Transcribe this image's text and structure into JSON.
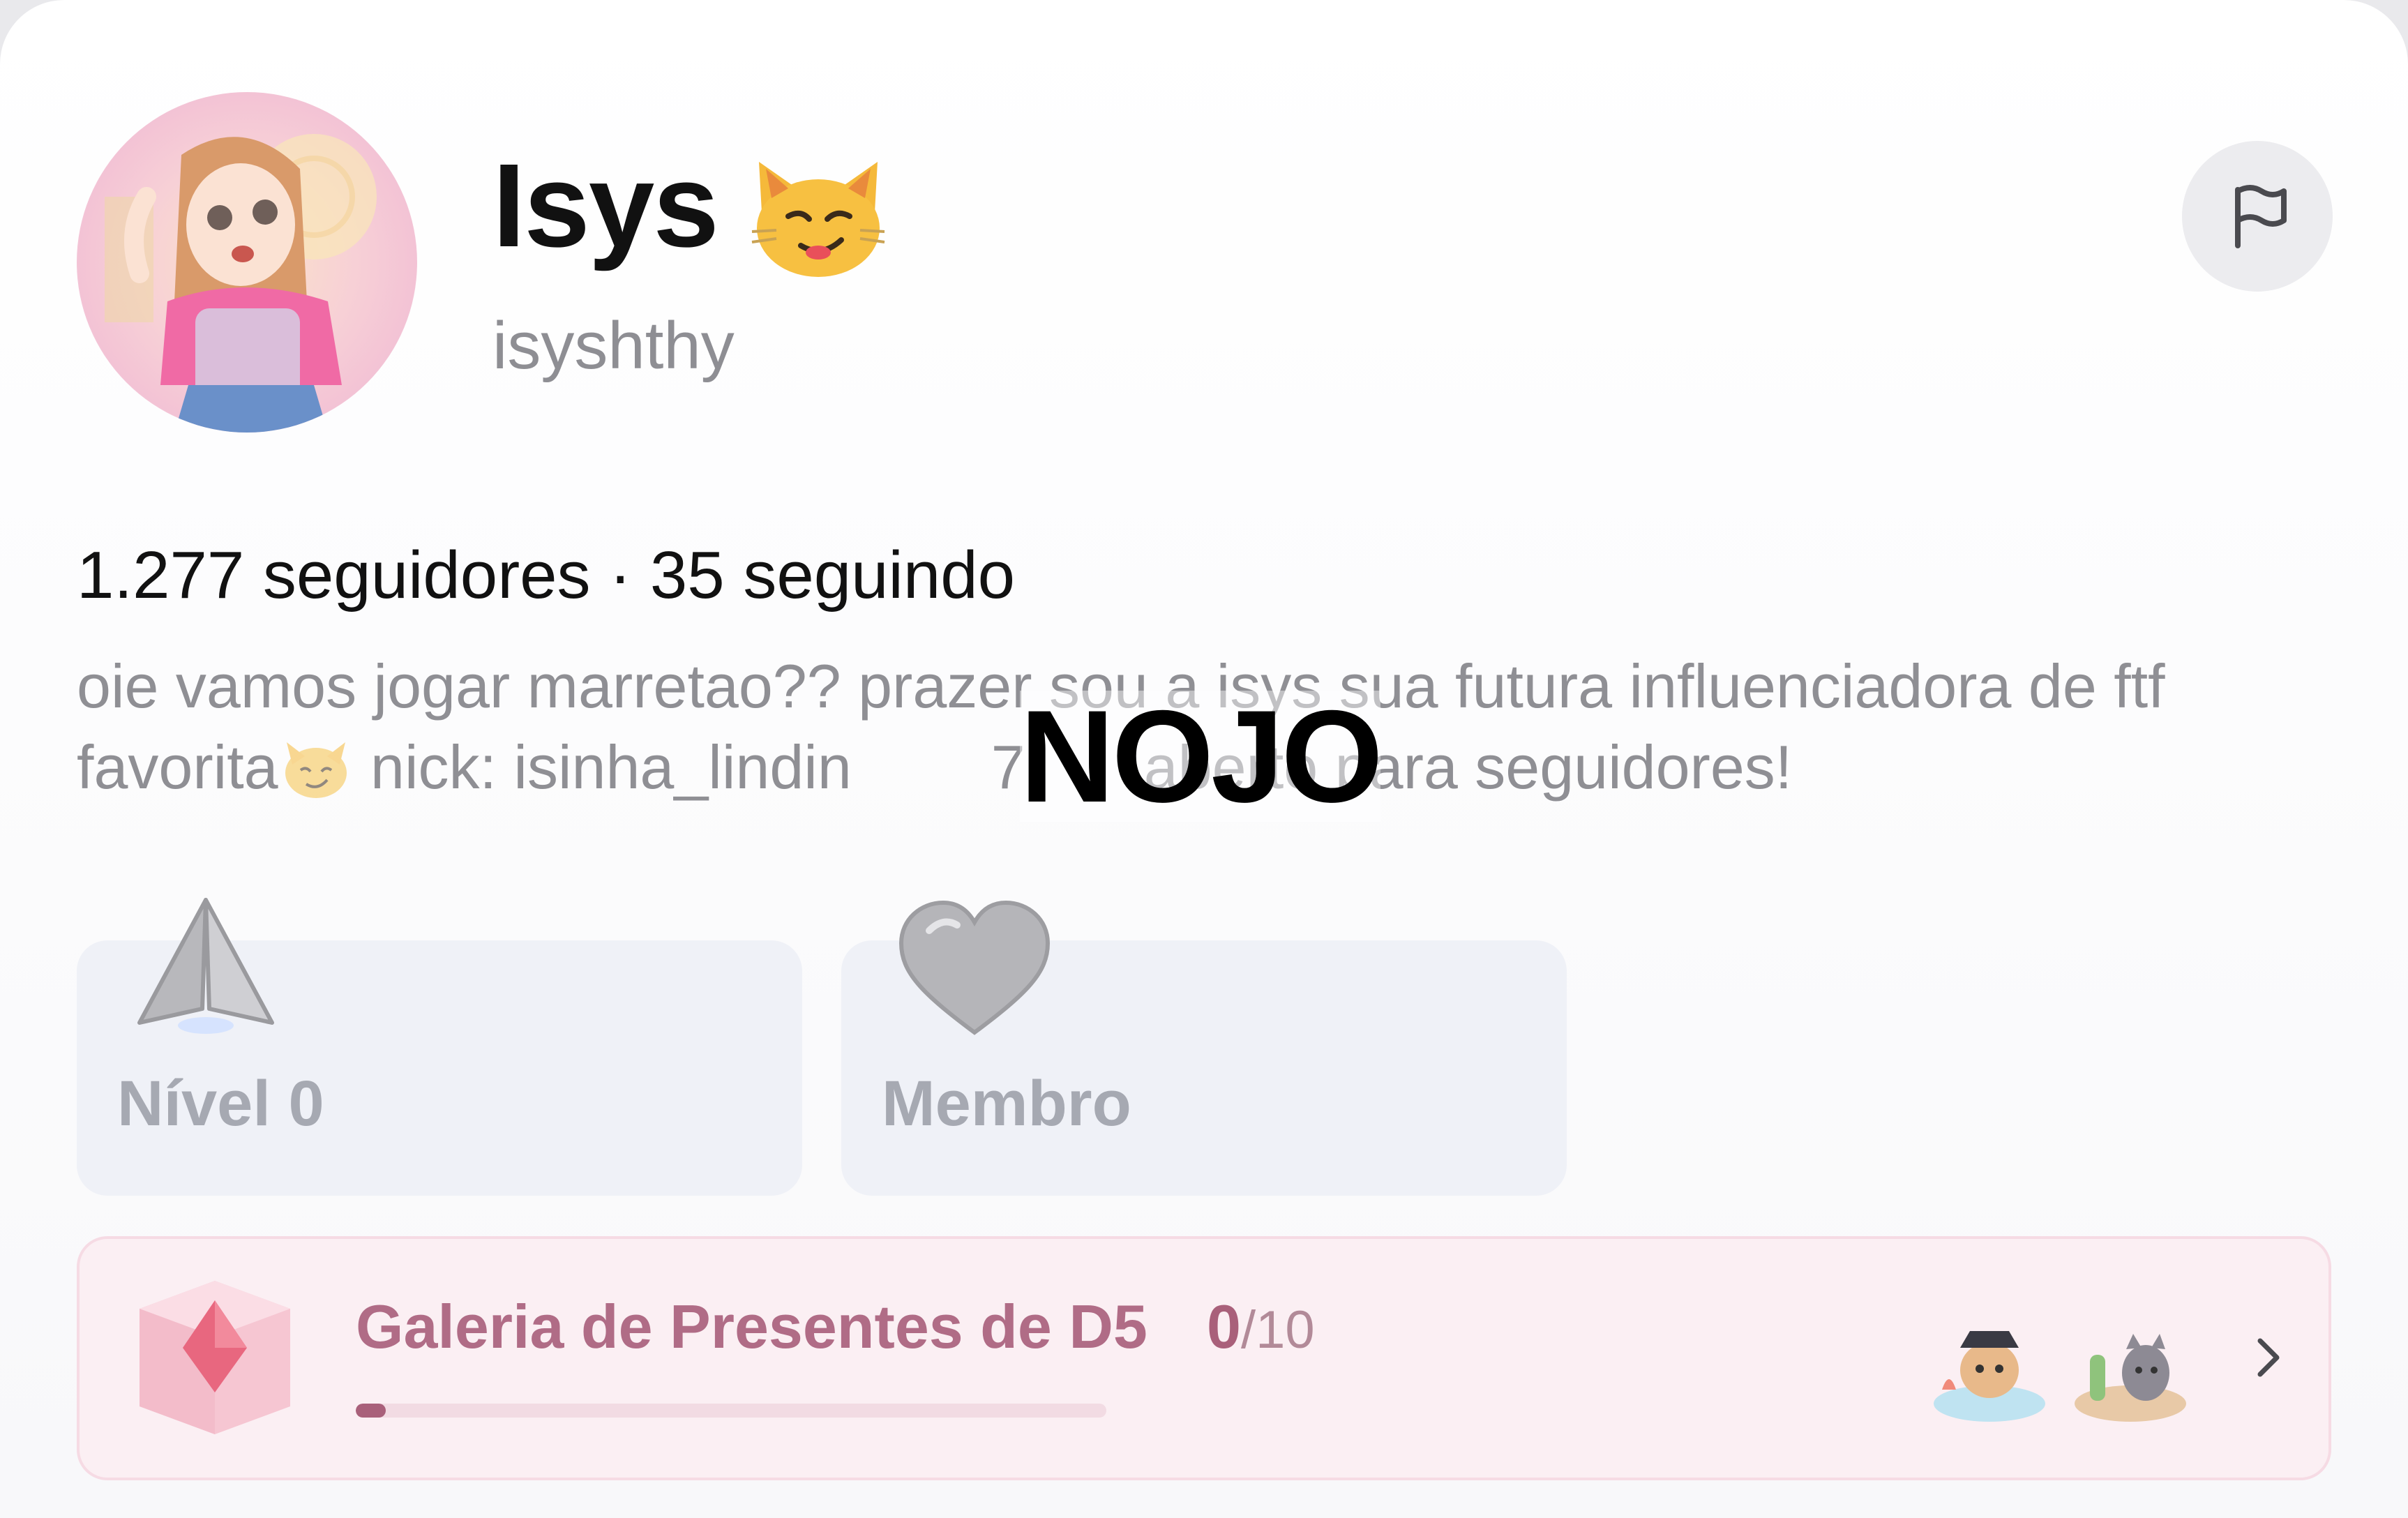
{
  "profile": {
    "display_name": "Isys",
    "username": "isyshthy",
    "stats_text": "1.277 seguidores · 35 seguindo",
    "bio_part1": "oie vamos jogar marretao?? prazer sou a isys sua futura  influenciadora de ftf favorita",
    "bio_part2": " nick: isinha_lindin",
    "bio_part3": "7",
    "bio_part4": "aberto para seguidores!",
    "overlay_text": "NOJO"
  },
  "badges": [
    {
      "label": "Nível 0",
      "icon": "level-triangle-icon"
    },
    {
      "label": "Membro",
      "icon": "heart-icon"
    }
  ],
  "gift_gallery": {
    "title": "Galeria de Presentes de D5",
    "count": "0",
    "total": "/10",
    "progress": 0.04,
    "accent_color": "#a9607a"
  },
  "colors": {
    "card_bg": "#eff1f7",
    "gift_bg": "#fbeff3"
  }
}
